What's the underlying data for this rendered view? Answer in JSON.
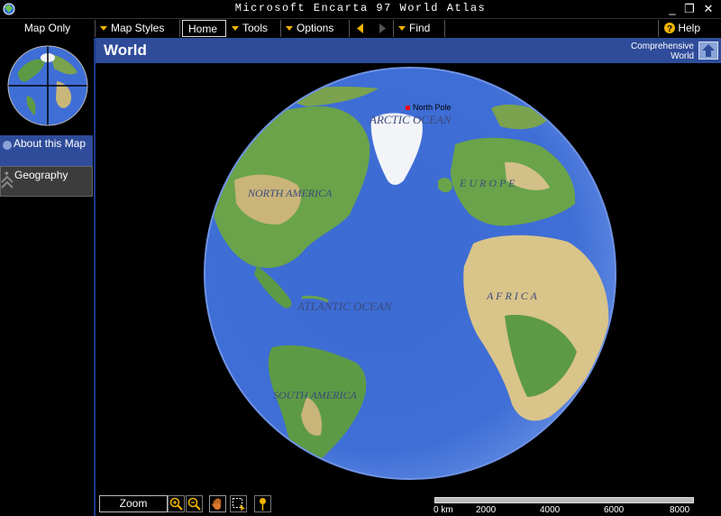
{
  "window": {
    "title": "Microsoft Encarta 97 World Atlas",
    "minimize_glyph": "_",
    "restore_glyph": "❐",
    "close_glyph": "✕"
  },
  "toolbar": {
    "map_only": "Map Only",
    "map_styles": "Map Styles",
    "home": "Home",
    "tools": "Tools",
    "options": "Options",
    "find": "Find",
    "help": "Help"
  },
  "sidebar": {
    "about": "About this Map",
    "geography": "Geography"
  },
  "header": {
    "title": "World",
    "comprehensive_line1": "Comprehensive",
    "comprehensive_line2": "World"
  },
  "map": {
    "labels": {
      "north_pole": "North Pole",
      "arctic_ocean": "ARCTIC OCEAN",
      "north_america": "NORTH AMERICA",
      "europe": "E U R O P E",
      "atlantic_ocean": "ATLANTIC OCEAN",
      "africa": "A F R I C A",
      "south_america": "SOUTH AMERICA"
    }
  },
  "bottom": {
    "zoom_label": "Zoom",
    "scale": {
      "unit_start": "0 km",
      "ticks": [
        "2000",
        "4000",
        "6000",
        "8000"
      ]
    }
  },
  "colors": {
    "accent_blue": "#2f4c9a",
    "ocean": "#3f6ed6",
    "land_green": "#5d9a45",
    "land_tan": "#d9c48a",
    "ice": "#f2f4f8",
    "triangle_gold": "#f0b400"
  }
}
